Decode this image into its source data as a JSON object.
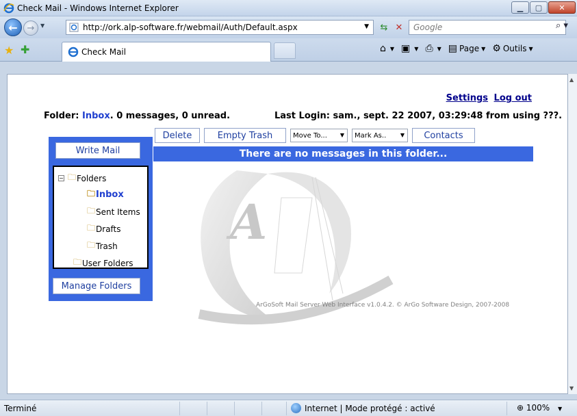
{
  "window": {
    "title": "Check Mail - Windows Internet Explorer",
    "minimize": "▁",
    "maximize": "▢",
    "close": "✕"
  },
  "address": {
    "url": "http://ork.alp-software.fr/webmail/Auth/Default.aspx",
    "search_placeholder": "Google"
  },
  "tab": {
    "label": "Check Mail"
  },
  "commands": {
    "page": "Page",
    "tools": "Outils"
  },
  "page": {
    "settings": "Settings",
    "logout": "Log out",
    "folder_prefix": "Folder:",
    "folder_name": "Inbox",
    "folder_counts": ". 0 messages, 0 unread.",
    "last_login": "Last Login: sam., sept. 22 2007, 03:29:48 from using ???.",
    "write_mail": "Write Mail",
    "manage_folders": "Manage Folders",
    "tree": {
      "root": "Folders",
      "items": [
        "Inbox",
        "Sent Items",
        "Drafts",
        "Trash"
      ],
      "user_folders": "User Folders"
    },
    "toolbar": {
      "delete": "Delete",
      "empty_trash": "Empty Trash",
      "move_to": "Move To...",
      "mark_as": "Mark As..",
      "contacts": "Contacts"
    },
    "no_messages": "There are no messages in this folder...",
    "footer": "ArGoSoft Mail Server Web Interface v1.0.4.2.  © ArGo Software Design, 2007-2008"
  },
  "status": {
    "text": "Terminé",
    "zone": "Internet | Mode protégé : activé",
    "zoom": "100%"
  }
}
